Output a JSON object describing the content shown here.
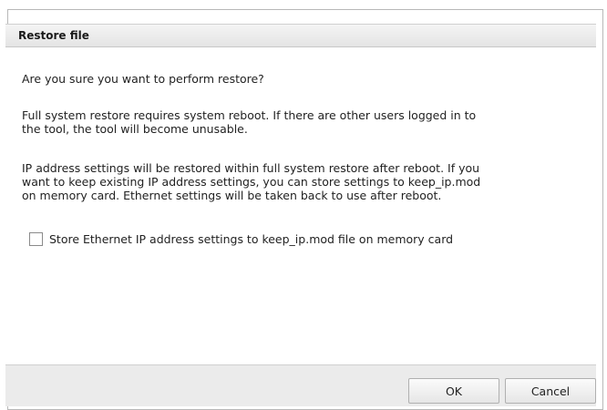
{
  "dialog": {
    "title": "Restore file",
    "question": "Are you sure you want to perform restore?",
    "warning_line1": "Full system restore requires system reboot. If there are other users logged in to",
    "warning_line2": "the tool, the tool will become unusable.",
    "info_line1": "IP address settings will be restored within full system restore after reboot. If you",
    "info_line2": "want to keep existing IP address settings, you can store settings to keep_ip.mod",
    "info_line3": "on memory card. Ethernet settings will be taken back to use after reboot.",
    "checkbox_label": "Store Ethernet IP address settings to keep_ip.mod file on memory card",
    "checkbox_checked": false,
    "ok_label": "OK",
    "cancel_label": "Cancel"
  }
}
